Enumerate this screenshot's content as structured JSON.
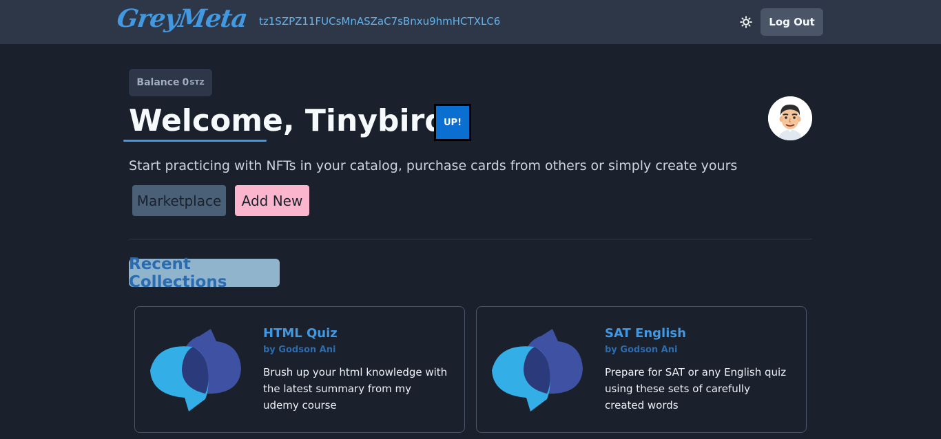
{
  "navbar": {
    "logo_text": "GreyMeta",
    "address": "tz1SZPZ11FUCsMnASZaC7sBnxu9hmHCTXLC6",
    "theme_icon": "sun-icon",
    "logout_label": "Log Out"
  },
  "balance": {
    "label": "Balance",
    "amount": "0",
    "unit": "STZ"
  },
  "welcome": {
    "title": "Welcome, Tinybird",
    "badge": "UP!",
    "subtitle": "Start practicing with NFTs in your catalog, purchase cards from others or simply create yours"
  },
  "actions": {
    "marketplace_label": "Marketplace",
    "add_new_label": "Add New"
  },
  "recent": {
    "title": "Recent Collections",
    "cards": [
      {
        "title": "HTML Quiz",
        "author": "by Godson Ani",
        "description": "Brush up your html knowledge with the latest summary from my udemy course"
      },
      {
        "title": "SAT English",
        "author": "by Godson Ani",
        "description": "Prepare for SAT or any English quiz using these sets of carefully created words"
      }
    ]
  },
  "colors": {
    "background": "#1a202c",
    "navbar": "#2d3748",
    "accent_blue": "#4299e1",
    "pink": "#fbb6ce",
    "badge_blue": "#0b6fd1"
  }
}
